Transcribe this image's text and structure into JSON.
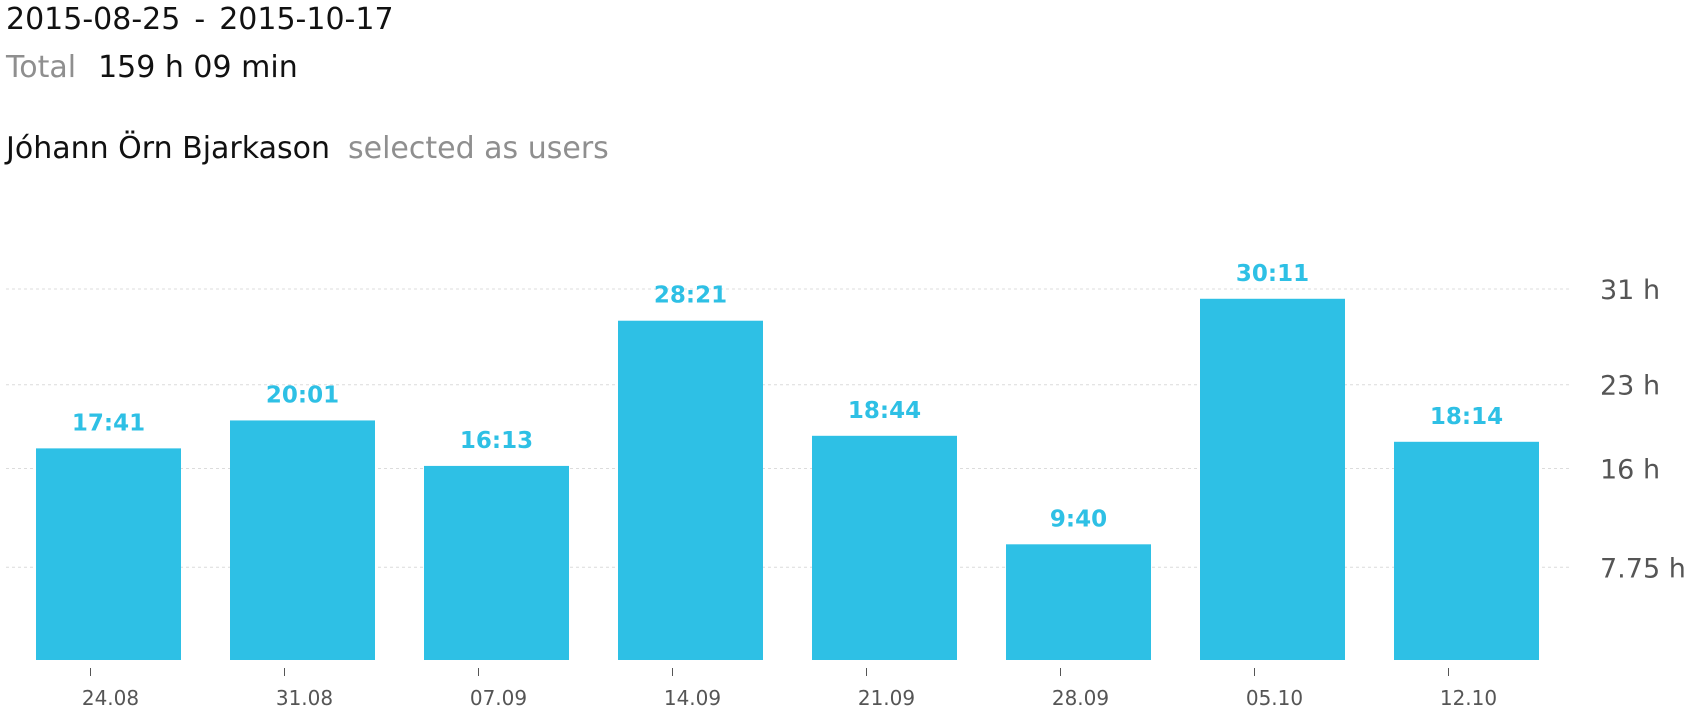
{
  "header": {
    "date_start": "2015-08-25",
    "date_separator": "-",
    "date_end": "2015-10-17",
    "total_label": "Total",
    "total_value": "159 h 09 min"
  },
  "filter": {
    "user_name": "Jóhann Örn Bjarkason",
    "suffix": "selected as users"
  },
  "colors": {
    "bar": "#2ec0e5",
    "grid": "#dcdcdc",
    "muted_text": "#8f8f8f"
  },
  "chart_data": {
    "type": "bar",
    "categories": [
      "24.08",
      "31.08",
      "07.09",
      "14.09",
      "21.09",
      "28.09",
      "05.10",
      "12.10"
    ],
    "values": [
      17.683,
      20.017,
      16.217,
      28.35,
      18.733,
      9.667,
      30.183,
      18.233
    ],
    "data_labels": [
      "17:41",
      "20:01",
      "16:13",
      "28:21",
      "18:44",
      "9:40",
      "30:11",
      "18:14"
    ],
    "y_ticks": [
      7.75,
      16,
      23,
      31
    ],
    "y_tick_labels": [
      "7.75 h",
      "16 h",
      "23 h",
      "31 h"
    ],
    "ylim": [
      0,
      31
    ],
    "grid": true,
    "y_axis_position": "right",
    "title": "",
    "xlabel": "",
    "ylabel": ""
  }
}
